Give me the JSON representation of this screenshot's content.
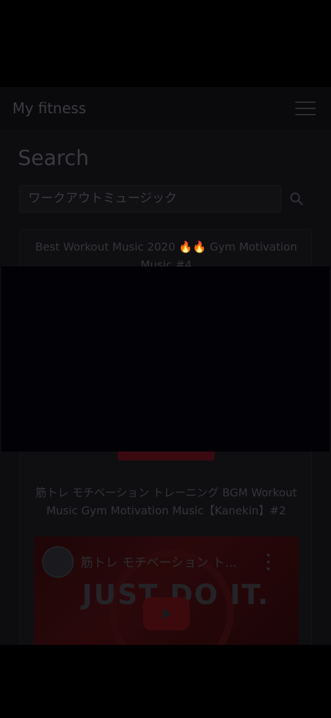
{
  "navbar": {
    "brand": "My fitness"
  },
  "page": {
    "title": "Search"
  },
  "search": {
    "value": "ワークアウトミュージック"
  },
  "results": [
    {
      "title": "Best Workout Music 2020 🔥🔥 Gym Motivation Music #4"
    },
    {
      "title": "筋トレ モチベーション トレーニング BGM Workout Music Gym Motivation Music【Kanekin】#2"
    }
  ],
  "player": {
    "video_title": "筋トレ モチベーション ト...",
    "thumbnail_text": "JUST DO IT."
  },
  "colors": {
    "accent": "#3a0a10",
    "background": "#0d0d10"
  }
}
